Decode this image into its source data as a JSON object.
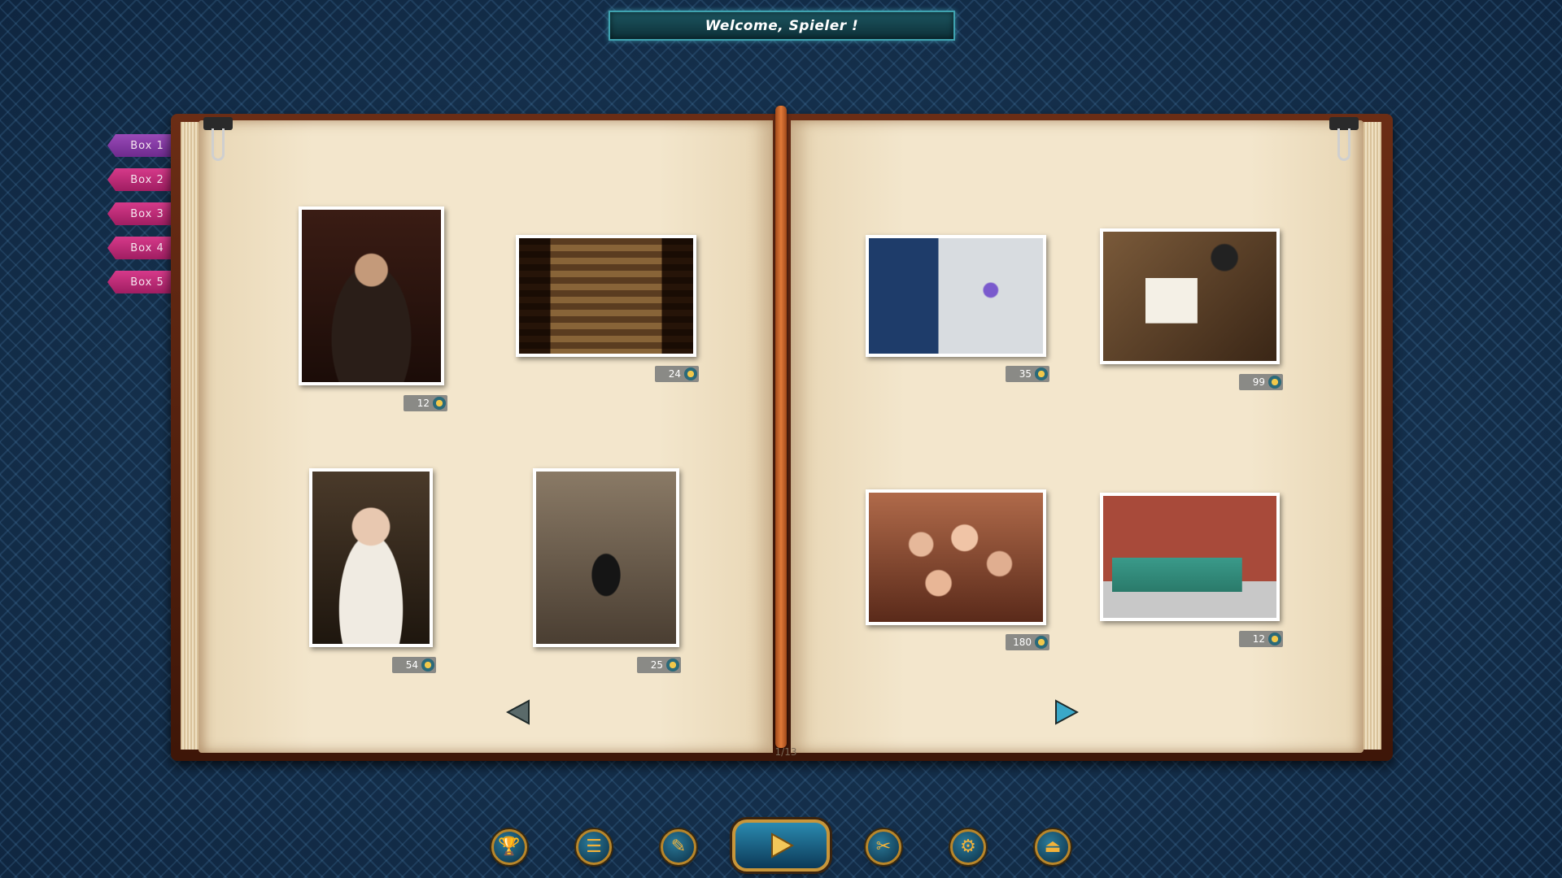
{
  "header": {
    "welcome": "Welcome, Spieler !"
  },
  "boxes": [
    {
      "label": "Box 1",
      "active": true
    },
    {
      "label": "Box 2"
    },
    {
      "label": "Box 3"
    },
    {
      "label": "Box 4"
    },
    {
      "label": "Box 5"
    }
  ],
  "left_page": {
    "puzzles": [
      {
        "subject": "man-with-cap-portrait",
        "price": "12"
      },
      {
        "subject": "bookshop-interior",
        "price": "24"
      },
      {
        "subject": "woman-with-key",
        "price": "54"
      },
      {
        "subject": "man-with-dog-street",
        "price": "25"
      }
    ]
  },
  "right_page": {
    "puzzles": [
      {
        "subject": "scientist-in-lab",
        "price": "35"
      },
      {
        "subject": "desk-with-camera-and-notebook",
        "price": "99"
      },
      {
        "subject": "doll-heads",
        "price": "180"
      },
      {
        "subject": "green-vintage-car",
        "price": "12"
      }
    ]
  },
  "pagination": {
    "page_label": "1/13"
  },
  "toolbar": {
    "icons": [
      "trophy-icon",
      "list-icon",
      "puzzle-edit-icon",
      "play-icon",
      "scissors-icon",
      "gear-icon",
      "exit-icon"
    ]
  },
  "colors": {
    "box_tab": "#c42e7a",
    "box_tab_active": "#8a3aa8",
    "accent_gold": "#c8963a",
    "header_border": "#3fa3b0"
  }
}
